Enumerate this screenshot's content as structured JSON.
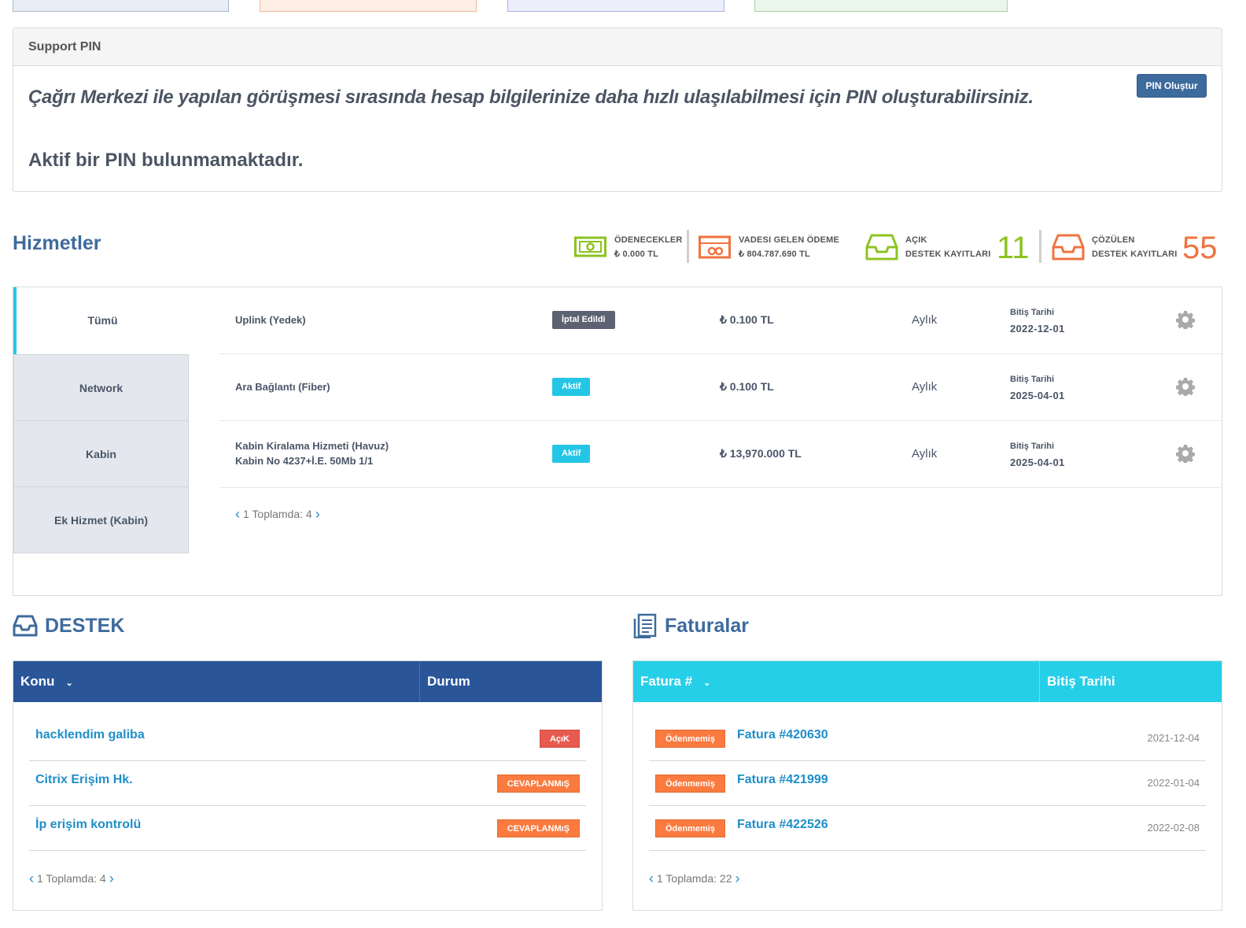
{
  "support_pin": {
    "title": "Support PIN",
    "intro": "Çağrı Merkezi ile yapılan görüşmesi sırasında hesap bilgilerinize daha hızlı ulaşılabilmesi için PIN oluşturabilirsiniz.",
    "status": "Aktif bir PIN bulunmamaktadır.",
    "create_button": "PIN Oluştur"
  },
  "services": {
    "title": "Hizmetler",
    "stats": {
      "payable_label": "ÖDENECEKLER",
      "payable_value": "₺ 0.000 TL",
      "due_label": "VADESI GELEN ÖDEME",
      "due_value": "₺ 804.787.690 TL",
      "open_label_1": "AÇIK",
      "open_label_2": "DESTEK KAYITLARI",
      "open_count": "11",
      "solved_label_1": "ÇÖZÜLEN",
      "solved_label_2": "DESTEK KAYITLARI",
      "solved_count": "55"
    },
    "tabs": [
      "Tümü",
      "Network",
      "Kabin",
      "Ek Hizmet (Kabin)"
    ],
    "rows": [
      {
        "name": "Uplink (Yedek)",
        "name2": "",
        "status": "İptal Edildi",
        "price": "₺ 0.100 TL",
        "cycle": "Aylık",
        "due_label": "Bitiş Tarihi",
        "due": "2022-12-01"
      },
      {
        "name": "Ara Bağlantı (Fiber)",
        "name2": "",
        "status": "Aktif",
        "price": "₺ 0.100 TL",
        "cycle": "Aylık",
        "due_label": "Bitiş Tarihi",
        "due": "2025-04-01"
      },
      {
        "name": "Kabin Kiralama Hizmeti (Havuz)",
        "name2": "Kabin No 4237+İ.E. 50Mb 1/1",
        "status": "Aktif",
        "price": "₺ 13,970.000 TL",
        "cycle": "Aylık",
        "due_label": "Bitiş Tarihi",
        "due": "2025-04-01"
      }
    ],
    "pager": "1 Toplamda: 4"
  },
  "support": {
    "title": "DESTEK",
    "col_subject": "Konu",
    "col_status": "Durum",
    "rows": [
      {
        "subject": "hacklendim galiba",
        "status": "AçıK"
      },
      {
        "subject": "Citrix Erişim Hk.",
        "status": "CEVAPLANMıŞ"
      },
      {
        "subject": "İp erişim kontrolü",
        "status": "CEVAPLANMıŞ"
      }
    ],
    "pager": "1 Toplamda: 4"
  },
  "invoices": {
    "title": "Faturalar",
    "col_number": "Fatura #",
    "col_due": "Bitiş Tarihi",
    "rows": [
      {
        "status": "Ödenmemiş",
        "number": "Fatura #420630",
        "date": "2021-12-04"
      },
      {
        "status": "Ödenmemiş",
        "number": "Fatura #421999",
        "date": "2022-01-04"
      },
      {
        "status": "Ödenmemiş",
        "number": "Fatura #422526",
        "date": "2022-02-08"
      }
    ],
    "pager": "1 Toplamda: 22"
  },
  "colors": {
    "primary": "#3e6b9d",
    "support_header": "#2a5599",
    "invoice_header": "#26cfe8",
    "green": "#8cc320",
    "orange": "#f0733f",
    "badge_red": "#e85a4f",
    "badge_orange": "#fa7a3f",
    "badge_cyan": "#24c6e6",
    "badge_gray": "#5b6271",
    "link": "#1e8ec8"
  }
}
